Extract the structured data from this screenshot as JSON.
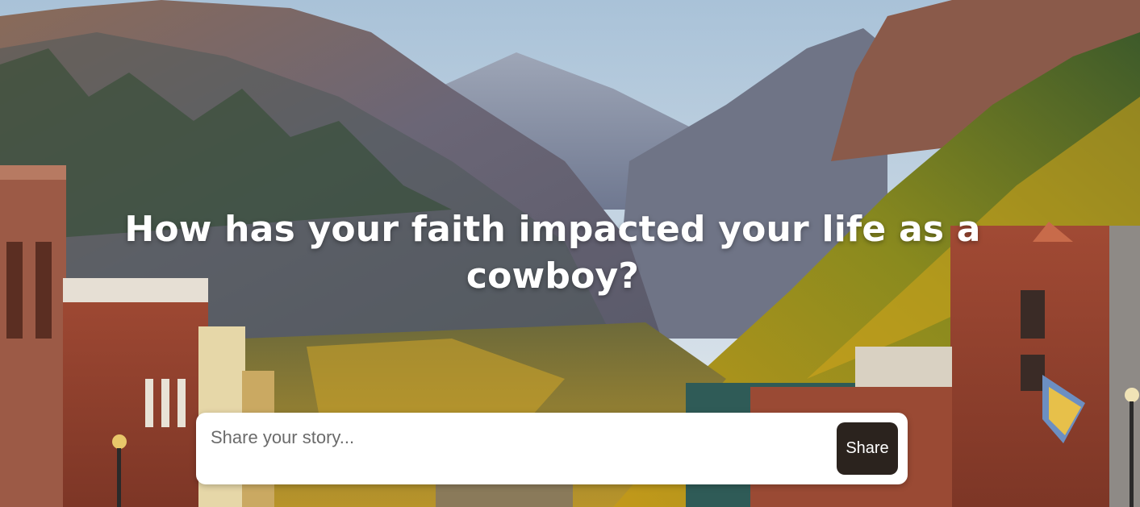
{
  "hero": {
    "background_image": "mountain-town-photo",
    "title": "How has your faith impacted your life as a cowboy?"
  },
  "story_form": {
    "placeholder": "Share your story...",
    "value": "",
    "share_label": "Share"
  },
  "colors": {
    "button_bg": "#2b231e",
    "button_text": "#ffffff",
    "title_text": "#ffffff",
    "panel_bg": "#ffffff"
  }
}
